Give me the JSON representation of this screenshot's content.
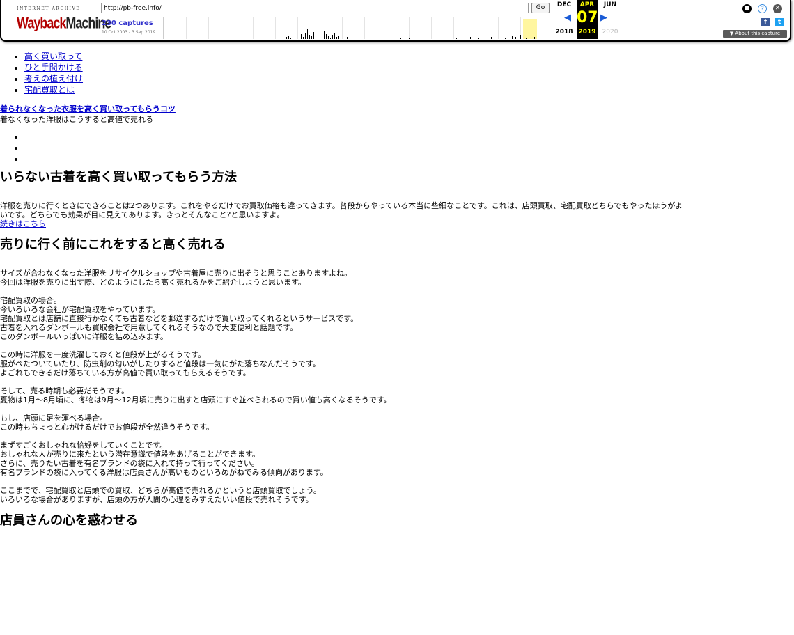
{
  "wayback": {
    "logo_top": "INTERNET ARCHIVE",
    "logo_red": "Wayback",
    "logo_dark": "Machine",
    "url": "http://pb-free.info/",
    "go_label": "Go",
    "captures": "230 captures",
    "range": "10 Oct 2003 - 3 Sep 2019",
    "months": {
      "prev": "DEC",
      "cur": "APR",
      "next": "JUN"
    },
    "day": "07",
    "years": {
      "prev": "2018",
      "cur": "2019",
      "next": "2020"
    },
    "about": "▼ About this capture"
  },
  "nav": [
    "高く買い取って",
    "ひと手間かける",
    "考えの植え付け",
    "宅配買取とは"
  ],
  "feature": {
    "link": "着られなくなった衣服を高く買い取ってもらうコツ",
    "sub": "着なくなった洋服はこうすると高値で売れる"
  },
  "article1": {
    "title": "いらない古着を高く買い取ってもらう方法",
    "body1": "洋服を売りに行くときにできることは2つあります。これをやるだけでお買取価格も違ってきます。普段からやっている本当に些細なことです。これは、店頭買取、宅配買取どちらでもやったほうがよ",
    "body2": "いです。どちらでも効果が目に見えてあります。きっとそんなこと?と思いますよ。",
    "more": "続きはこちら"
  },
  "article2": {
    "title": "売りに行く前にこれをすると高く売れる",
    "lines": [
      "サイズが合わなくなった洋服をリサイクルショップや古着屋に売りに出そうと思うことありますよね。",
      "今回は洋服を売りに出す際、どのようにしたら高く売れるかをご紹介しようと思います。",
      "",
      "宅配買取の場合。",
      "今いろいろな会社が宅配買取をやっています。",
      "宅配買取とは店舗に直接行かなくても古着などを郵送するだけで買い取ってくれるというサービスです。",
      "古着を入れるダンボールも買取会社で用意してくれるそうなので大変便利と話題です。",
      "このダンボールいっぱいに洋服を詰め込みます。",
      "",
      "この時に洋服を一度洗濯しておくと値段が上がるそうです。",
      "服がべたついていたり、防虫剤の匂いがしたりすると値段は一気にがた落ちなんだそうです。",
      "よごれもできるだけ落ちている方が高値で買い取ってもらえるそうです。",
      "",
      "そして、売る時期も必要だそうです。",
      "夏物は1月～8月頃に、冬物は9月～12月頃に売りに出すと店頭にすぐ並べられるので買い値も高くなるそうです。",
      "",
      "もし、店頭に足を運べる場合。",
      "この時もちょっと心がけるだけでお値段が全然違うそうです。",
      "",
      "まずすごくおしゃれな恰好をしていくことです。",
      "おしゃれな人が売りに来たという潜在意識で値段をあげることができます。",
      "さらに、売りたい古着を有名ブランドの袋に入れて持って行ってください。",
      "有名ブランドの袋に入ってくる洋服は店員さんが高いものといろめがねでみる傾向があります。",
      "",
      "ここまでで、宅配買取と店頭での買取、どちらが高値で売れるかというと店頭買取でしょう。",
      "いろいろな場合がありますが、店頭の方が人間の心理をみすえたいい値段で売れそうです。"
    ]
  },
  "article3": {
    "title": "店員さんの心を惑わせる"
  }
}
